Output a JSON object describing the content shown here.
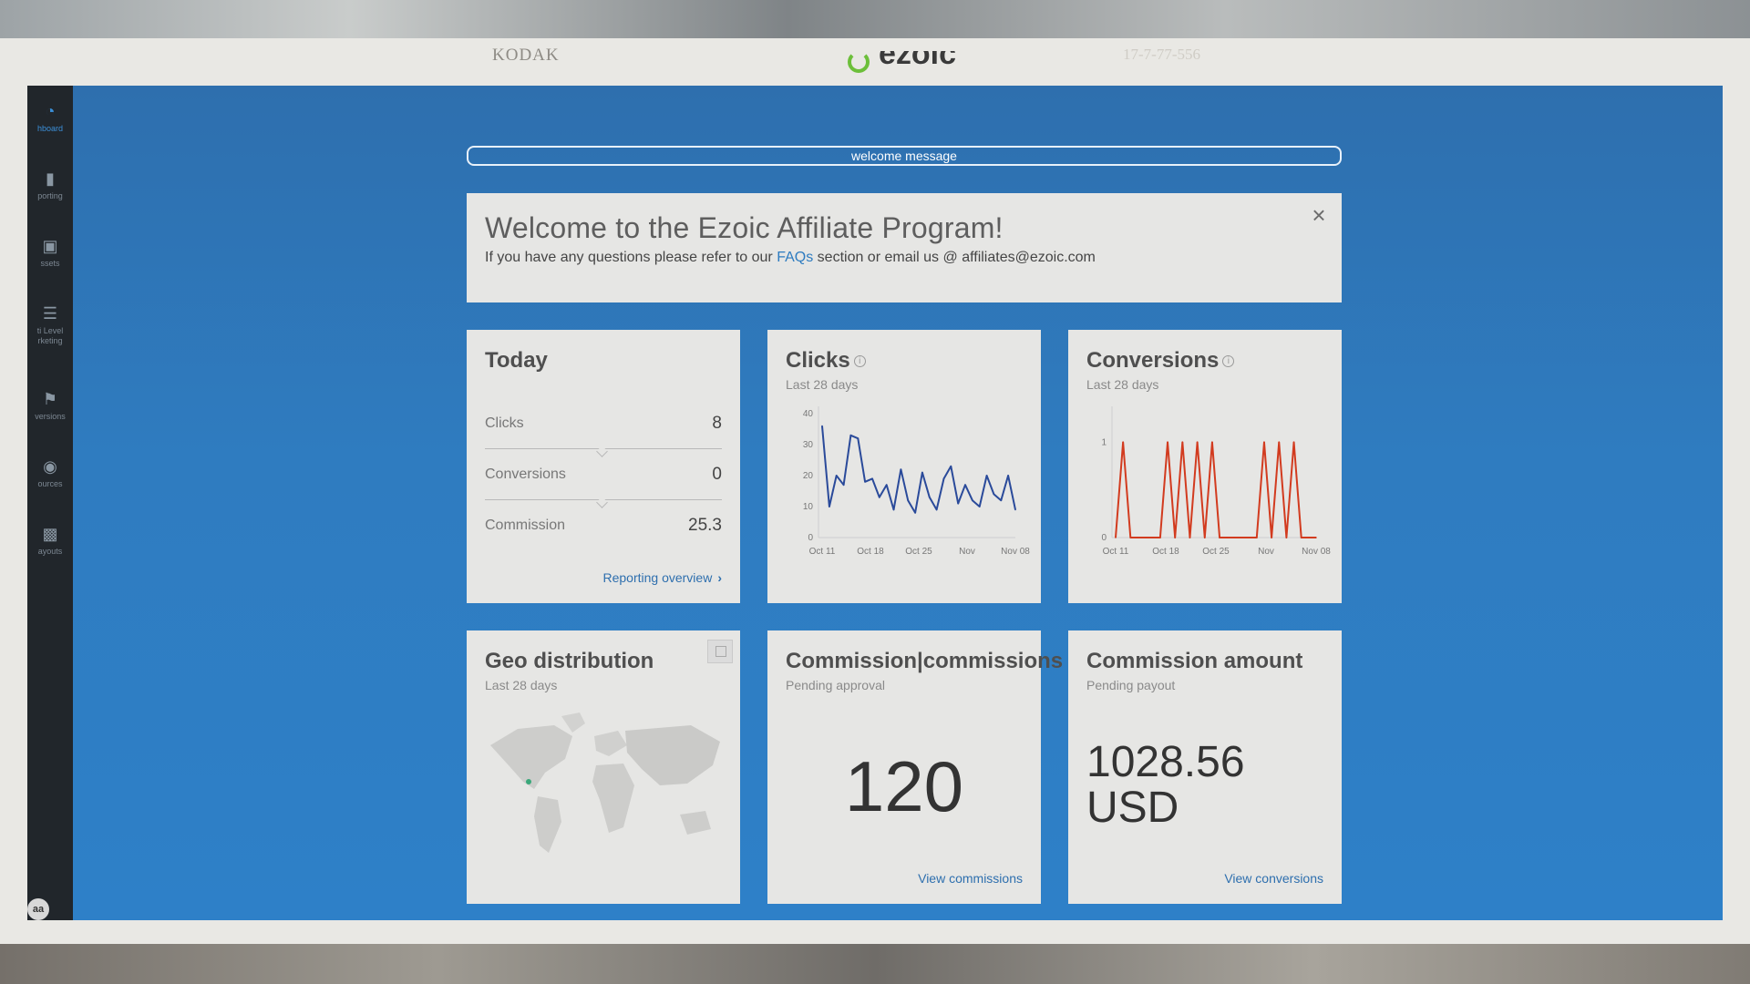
{
  "frame": {
    "brand": "KODAK",
    "code": "17-7-77-556",
    "logo_text": "ezoic"
  },
  "sidebar": {
    "items": [
      {
        "label": "hboard",
        "icon": "dashboard-icon"
      },
      {
        "label": "porting",
        "icon": "bar-chart-icon"
      },
      {
        "label": "ssets",
        "icon": "image-icon"
      },
      {
        "label": "ti Level\nrketing",
        "icon": "hierarchy-icon"
      },
      {
        "label": "versions",
        "icon": "flag-icon"
      },
      {
        "label": "ources",
        "icon": "globe-icon"
      },
      {
        "label": "ayouts",
        "icon": "wallet-icon"
      }
    ],
    "avatar": "aa"
  },
  "welcome_bar": "welcome message",
  "welcome": {
    "title": "Welcome to the Ezoic Affiliate Program!",
    "text_before": "If you have any questions please refer to our ",
    "link": "FAQs",
    "text_after": " section or email us @ affiliates@ezoic.com",
    "close": "×"
  },
  "today": {
    "title": "Today",
    "rows": [
      {
        "label": "Clicks",
        "value": "8"
      },
      {
        "label": "Conversions",
        "value": "0"
      },
      {
        "label": "Commission",
        "value": "25.3"
      }
    ],
    "link": "Reporting overview",
    "link_chevron": "›"
  },
  "clicks_chart": {
    "title": "Clicks",
    "subtitle": "Last 28 days",
    "info": "i"
  },
  "conversions_chart": {
    "title": "Conversions",
    "subtitle": "Last 28 days",
    "info": "i"
  },
  "geo": {
    "title": "Geo distribution",
    "subtitle": "Last 28 days"
  },
  "commissions": {
    "title": "Commission|commissions",
    "subtitle": "Pending approval",
    "value": "120",
    "link": "View commissions"
  },
  "amount": {
    "title": "Commission amount",
    "subtitle": "Pending payout",
    "value_line1": "1028.56",
    "value_line2": "USD",
    "link": "View conversions"
  },
  "colors": {
    "accent": "#2e7cc0",
    "clicks_line": "#2a4a9a",
    "conversions_line": "#d23b1f",
    "screen_bg": "#2f7cc0"
  },
  "chart_data": [
    {
      "type": "line",
      "title": "Clicks",
      "subtitle": "Last 28 days",
      "x_tick_labels": [
        "Oct 11",
        "Oct 18",
        "Oct 25",
        "Nov",
        "Nov 08"
      ],
      "y_ticks": [
        0,
        10,
        20,
        30,
        40
      ],
      "ylim": [
        0,
        40
      ],
      "series": [
        {
          "values": [
            36,
            10,
            20,
            17,
            33,
            32,
            18,
            19,
            13,
            17,
            9,
            22,
            12,
            8,
            21,
            13,
            9,
            19,
            23,
            11,
            17,
            12,
            10,
            20,
            14,
            12,
            20,
            9
          ]
        }
      ]
    },
    {
      "type": "line",
      "title": "Conversions",
      "subtitle": "Last 28 days",
      "x_tick_labels": [
        "Oct 11",
        "Oct 18",
        "Oct 25",
        "Nov",
        "Nov 08"
      ],
      "y_ticks": [
        0,
        1
      ],
      "ylim": [
        0,
        1.3
      ],
      "series": [
        {
          "values": [
            0,
            1,
            0,
            0,
            0,
            0,
            0,
            1,
            0,
            1,
            0,
            1,
            0,
            1,
            0,
            0,
            0,
            0,
            0,
            0,
            1,
            0,
            1,
            0,
            1,
            0,
            0,
            0
          ]
        }
      ]
    }
  ]
}
